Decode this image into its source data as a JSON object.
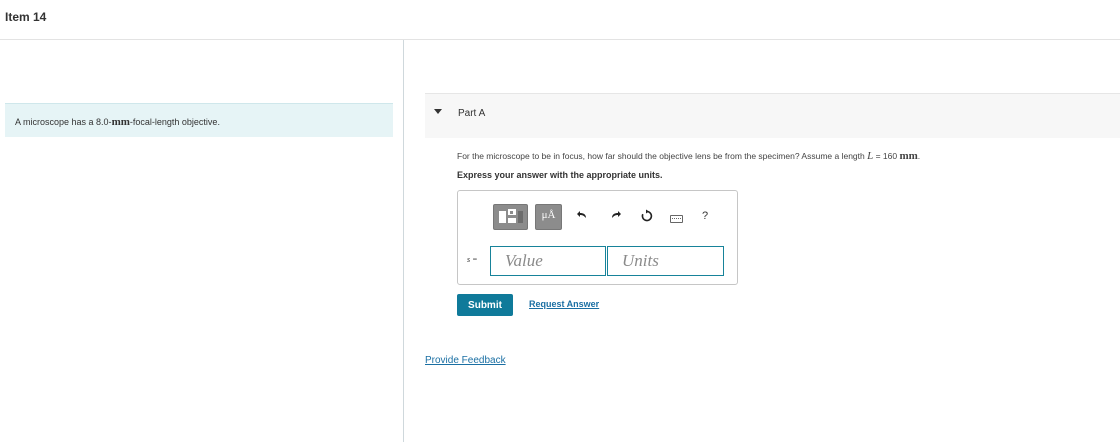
{
  "item": {
    "title": "Item 14"
  },
  "intro": {
    "text_before": "A microscope has a 8.0-",
    "unit": "mm",
    "text_after": "-focal-length objective."
  },
  "part": {
    "label": "Part A"
  },
  "question": {
    "text_before": "For the microscope to be in focus, how far should the objective lens be from the specimen? Assume a length ",
    "variable": "L",
    "text_middle": " = 160 ",
    "unit": "mm",
    "text_after": "."
  },
  "instruction": "Express your answer with the appropriate units.",
  "toolbar": {
    "templates_icon": "templates-icon",
    "units_button": "μÅ",
    "undo_icon": "undo-icon",
    "redo_icon": "redo-icon",
    "reset_icon": "reset-icon",
    "keyboard_icon": "keyboard-icon",
    "help_label": "?"
  },
  "answer": {
    "variable_label": "s =",
    "value_placeholder": "Value",
    "units_placeholder": "Units"
  },
  "actions": {
    "submit_label": "Submit",
    "request_answer_label": "Request Answer",
    "feedback_label": "Provide Feedback"
  },
  "colors": {
    "accent": "#0f7a9a",
    "link": "#1a6fa3",
    "intro_bg": "#e6f4f6",
    "field_border": "#17839a"
  }
}
